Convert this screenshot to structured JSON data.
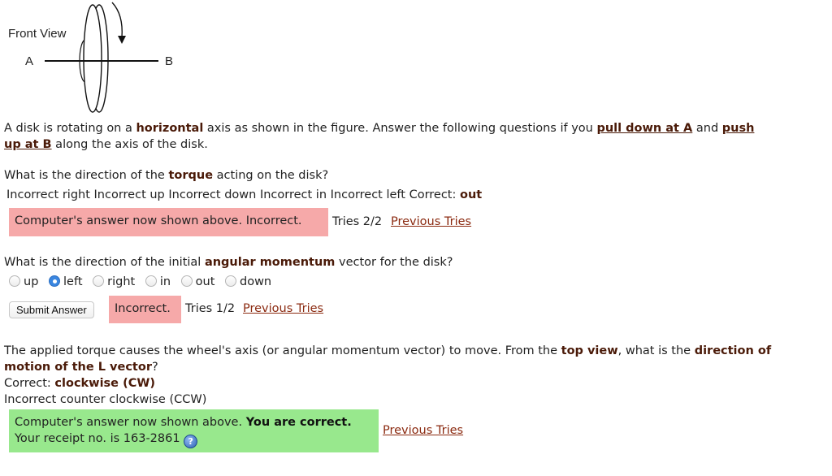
{
  "figure": {
    "title": "Front View",
    "label_a": "A",
    "label_b": "B"
  },
  "intro": {
    "part1": "A disk is rotating on a ",
    "horizontal": "horizontal",
    "part2": " axis as shown in the figure. Answer the following questions if you ",
    "pull_down": "pull down at A",
    "and": " and ",
    "push": "push",
    "up_at_b": "up at B",
    "part3": " along the axis of the disk."
  },
  "q1": {
    "prompt_pre": "What is the direction of the ",
    "prompt_bold": "torque",
    "prompt_post": " acting on the disk?",
    "answers_text": "Incorrect right Incorrect up Incorrect down Incorrect in Incorrect left Correct: ",
    "correct_answer": "out",
    "feedback": "Computer's answer now shown above. Incorrect.",
    "tries": "Tries 2/2",
    "previous_tries": "Previous Tries"
  },
  "q2": {
    "prompt_pre": "What is the direction of the initial ",
    "prompt_bold": "angular momentum",
    "prompt_post": " vector for the disk?",
    "options": [
      "up",
      "left",
      "right",
      "in",
      "out",
      "down"
    ],
    "selected": "left",
    "submit_label": "Submit Answer",
    "feedback": "Incorrect.",
    "tries": "Tries 1/2",
    "previous_tries": "Previous Tries"
  },
  "q3": {
    "prompt_pre": "The applied torque causes the wheel's axis (or angular momentum vector) to move. From the ",
    "top_view": "top view",
    "prompt_mid": ", what is the ",
    "direction_of": "direction of",
    "motion": "motion of the L vector",
    "prompt_end": "?",
    "correct_prefix": "Correct: ",
    "correct_answer": "clockwise (CW)",
    "incorrect_line": "Incorrect counter clockwise (CCW)",
    "feedback_pre": "Computer's answer now shown above. ",
    "feedback_bold": "You are correct.",
    "receipt": "Your receipt no. is 163-2861",
    "help_icon_glyph": "?",
    "previous_tries": "Previous Tries"
  },
  "colors": {
    "incorrect_bg": "#f6a9a9",
    "correct_bg": "#98e88d",
    "link": "#8b2a10",
    "bold_dark": "#4a1a08"
  }
}
